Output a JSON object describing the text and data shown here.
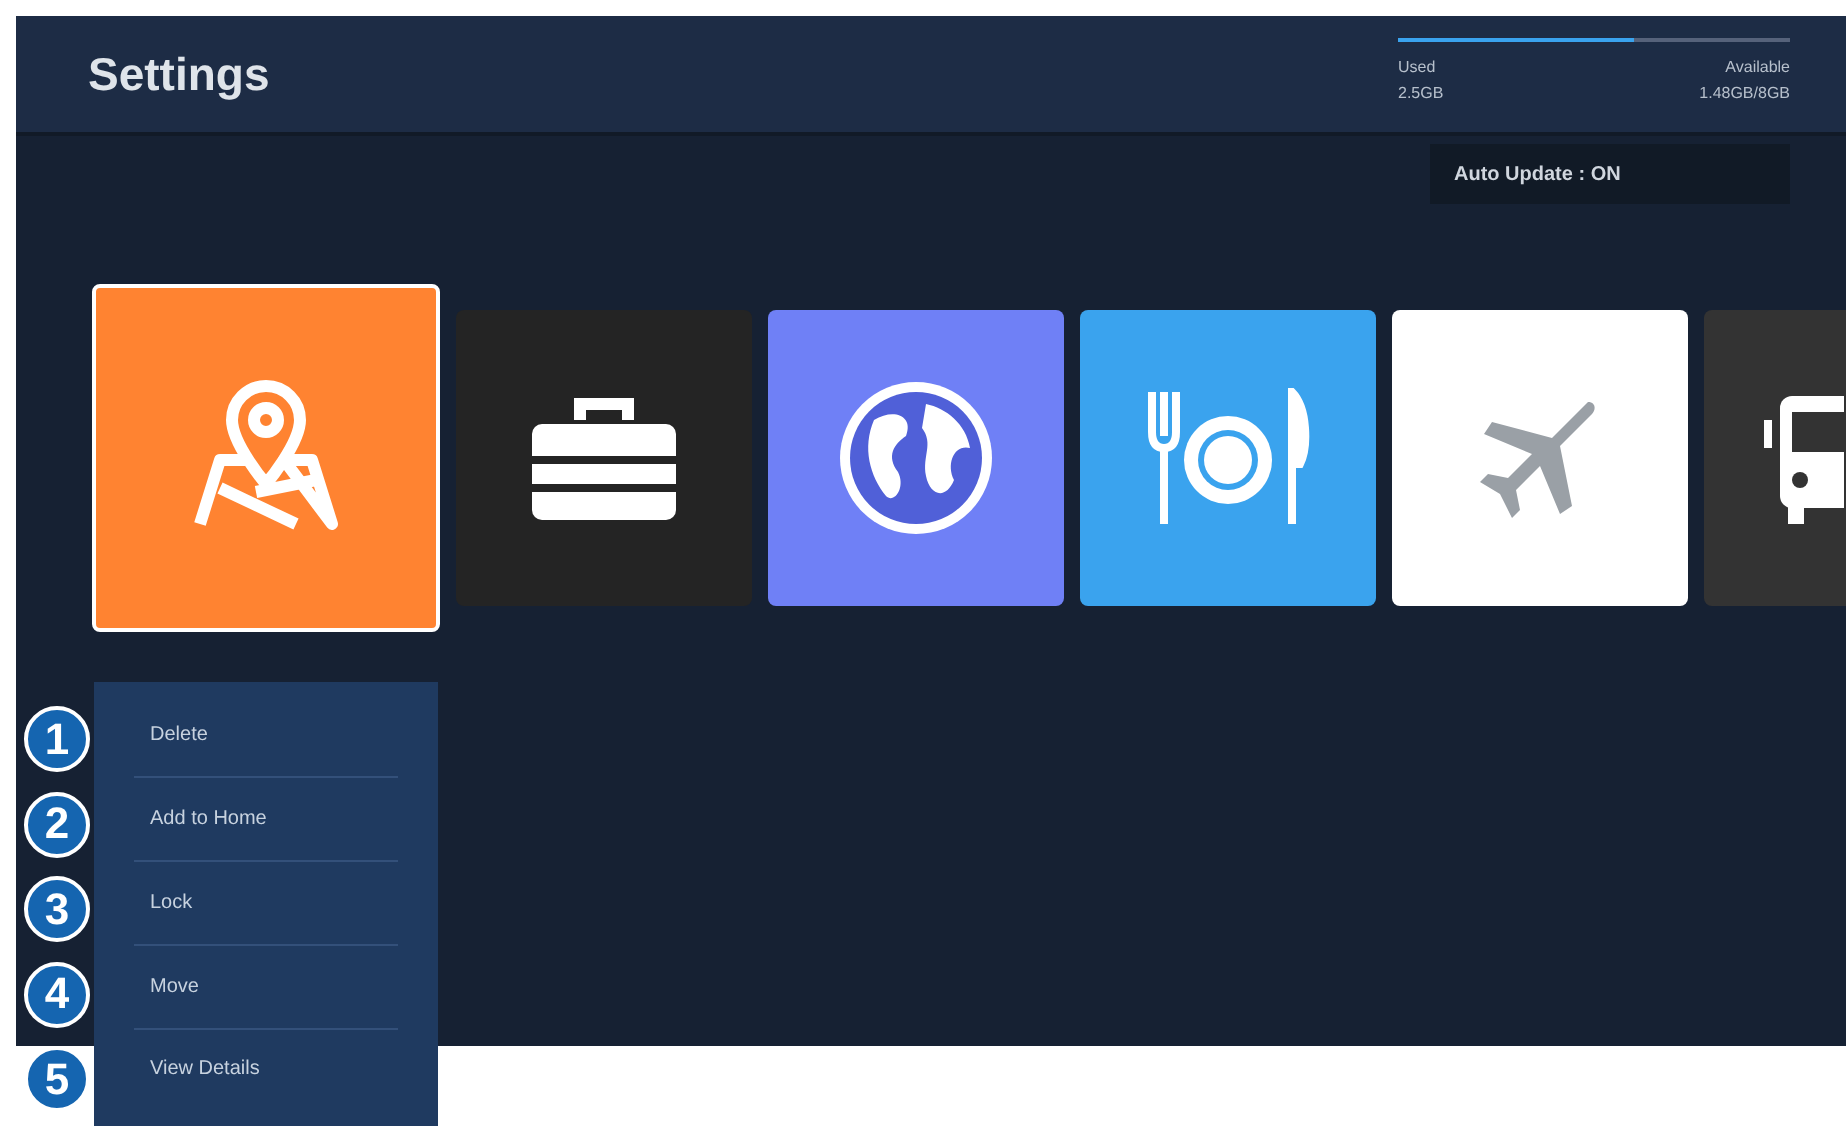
{
  "header": {
    "title": "Settings",
    "storage": {
      "level": 0.6,
      "used_label": "Used",
      "available_label": "Available",
      "used_value": "2.5GB",
      "available_value": "1.48GB/8GB"
    }
  },
  "auto_update": "Auto Update : ON",
  "apps": [
    {
      "kind": "map",
      "selected": true,
      "color": "#ff8331"
    },
    {
      "kind": "briefcase",
      "selected": false,
      "color": "#242424"
    },
    {
      "kind": "globe",
      "selected": false,
      "color": "#6f80f6"
    },
    {
      "kind": "dining",
      "selected": false,
      "color": "#3aa3ee"
    },
    {
      "kind": "plane",
      "selected": false,
      "color": "#ffffff"
    },
    {
      "kind": "bus",
      "selected": false,
      "color": "#333333"
    }
  ],
  "menu": [
    {
      "number": "1",
      "label": "Delete"
    },
    {
      "number": "2",
      "label": "Add to Home"
    },
    {
      "number": "3",
      "label": "Lock"
    },
    {
      "number": "4",
      "label": "Move"
    },
    {
      "number": "5",
      "label": "View Details"
    }
  ]
}
